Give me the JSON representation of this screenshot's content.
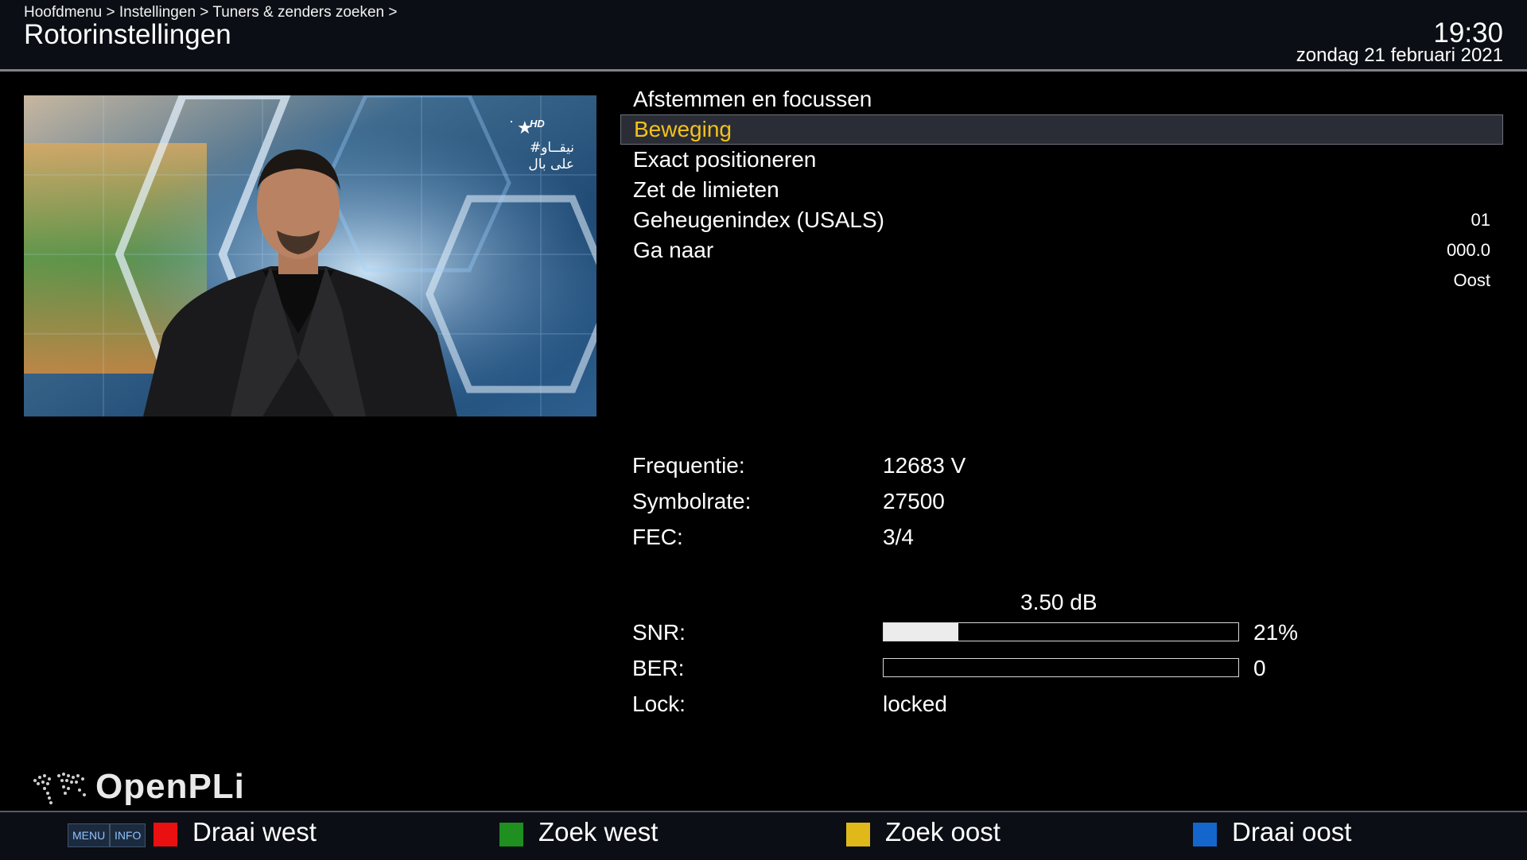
{
  "header": {
    "breadcrumb": "Hoofdmenu > Instellingen > Tuners & zenders zoeken >",
    "title": "Rotorinstellingen",
    "time": "19:30",
    "date": "zondag 21 februari 2021"
  },
  "preview": {
    "channel_logo_text_1": "#نيقــاو",
    "channel_logo_text_2": "على بال",
    "channel_badge": "HD"
  },
  "menu": {
    "items": [
      {
        "label": "Afstemmen en focussen",
        "value": ""
      },
      {
        "label": "Beweging",
        "value": "",
        "selected": true
      },
      {
        "label": "Exact positioneren",
        "value": ""
      },
      {
        "label": "Zet de limieten",
        "value": ""
      },
      {
        "label": "Geheugenindex (USALS)",
        "value": "01"
      },
      {
        "label": "Ga naar",
        "value": "000.0"
      },
      {
        "label": "",
        "value": "Oost"
      }
    ]
  },
  "tuner": {
    "frequency_label": "Frequentie:",
    "frequency_value": "12683 V",
    "symbolrate_label": "Symbolrate:",
    "symbolrate_value": "27500",
    "fec_label": "FEC:",
    "fec_value": "3/4",
    "snr_db": "3.50 dB",
    "snr_label": "SNR:",
    "snr_percent_text": "21%",
    "snr_fraction": 0.21,
    "ber_label": "BER:",
    "ber_value": "0",
    "ber_fraction": 0,
    "lock_label": "Lock:",
    "lock_value": "locked"
  },
  "brand": {
    "logo_text": "OpenPLi",
    "logo_icon": "world-map-dots-icon"
  },
  "footer": {
    "menu_key": "MENU",
    "info_key": "INFO",
    "red_label": "Draai west",
    "green_label": "Zoek west",
    "yellow_label": "Zoek oost",
    "blue_label": "Draai oost",
    "colors": {
      "red": "#e81010",
      "green": "#1f8f1f",
      "yellow": "#e0b81a",
      "blue": "#1466cc"
    }
  },
  "colors": {
    "accent_selected_text": "#f2c21b",
    "background": "#000000",
    "header_bg": "#0b0e14"
  }
}
